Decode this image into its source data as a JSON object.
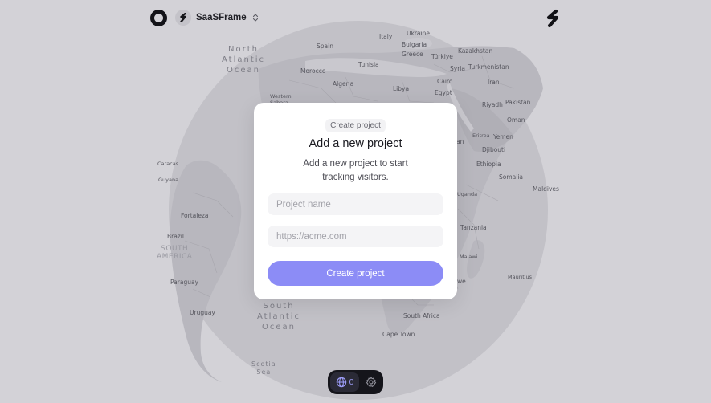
{
  "header": {
    "project_name": "SaaSFrame"
  },
  "map": {
    "places": [
      {
        "id": "ukraine",
        "label": "Ukraine"
      },
      {
        "id": "spain",
        "label": "Spain"
      },
      {
        "id": "italy",
        "label": "Italy"
      },
      {
        "id": "bulgaria",
        "label": "Bulgaria"
      },
      {
        "id": "kazakhstan",
        "label": "Kazakhstan"
      },
      {
        "id": "greece",
        "label": "Greece"
      },
      {
        "id": "turkiye",
        "label": "Türkiye"
      },
      {
        "id": "tunisia",
        "label": "Tunisia"
      },
      {
        "id": "turkmenistan",
        "label": "Turkmenistan"
      },
      {
        "id": "morocco",
        "label": "Morocco"
      },
      {
        "id": "syria",
        "label": "Syria"
      },
      {
        "id": "algeria",
        "label": "Algeria"
      },
      {
        "id": "cairo",
        "label": "Cairo"
      },
      {
        "id": "iran",
        "label": "Iran"
      },
      {
        "id": "libya",
        "label": "Libya"
      },
      {
        "id": "egypt",
        "label": "Egypt"
      },
      {
        "id": "western-sahara",
        "label": "Western Sahara"
      },
      {
        "id": "pakistan",
        "label": "Pakistan"
      },
      {
        "id": "riyadh",
        "label": "Riyadh"
      },
      {
        "id": "oman",
        "label": "Oman"
      },
      {
        "id": "eritrea",
        "label": "Eritrea"
      },
      {
        "id": "yemen",
        "label": "Yemen"
      },
      {
        "id": "djibouti",
        "label": "Djibouti"
      },
      {
        "id": "ethiopia",
        "label": "Ethiopia"
      },
      {
        "id": "somalia",
        "label": "Somalia"
      },
      {
        "id": "maldives",
        "label": "Maldives"
      },
      {
        "id": "uganda",
        "label": "Uganda"
      },
      {
        "id": "tanzania",
        "label": "Tanzania"
      },
      {
        "id": "malawi",
        "label": "Malawi"
      },
      {
        "id": "mauritius",
        "label": "Mauritius"
      },
      {
        "id": "zimbabwe-fragment",
        "label": "we"
      },
      {
        "id": "south-africa",
        "label": "South Africa"
      },
      {
        "id": "cape-town",
        "label": "Cape Town"
      },
      {
        "id": "caracas",
        "label": "Caracas"
      },
      {
        "id": "guyana",
        "label": "Guyana"
      },
      {
        "id": "fortaleza",
        "label": "Fortaleza"
      },
      {
        "id": "brazil",
        "label": "Brazil"
      },
      {
        "id": "paraguay",
        "label": "Paraguay"
      },
      {
        "id": "uruguay",
        "label": "Uruguay"
      }
    ],
    "fragments": {
      "an": "an"
    },
    "oceans": {
      "north_atlantic": [
        "North",
        "Atlantic",
        "Ocean"
      ],
      "south_atlantic": [
        "South",
        "Atlantic",
        "Ocean"
      ],
      "scotia_sea": [
        "Scotia",
        "Sea"
      ]
    },
    "regions": {
      "south_america": [
        "SOUTH",
        "AMERICA"
      ]
    }
  },
  "modal": {
    "eyebrow": "Create project",
    "title": "Add a new project",
    "description": "Add a new project to start tracking visitors.",
    "name_placeholder": "Project name",
    "name_value": "",
    "url_placeholder": "https://acme.com",
    "url_value": "",
    "submit_label": "Create project"
  },
  "toolbar": {
    "visitor_count": "0"
  },
  "colors": {
    "background": "#d3d2d7",
    "globe": "#c2c1c7",
    "land": "#b7b6bd",
    "accent": "#8c8cf6",
    "toolbar": "#15151b"
  },
  "icons": {
    "logo": "ring-logo-icon",
    "project": "saasframe-logo-icon",
    "switcher": "chevron-up-down-icon",
    "brand": "s-logo-icon",
    "visitors": "globe-icon",
    "settings": "gear-icon"
  }
}
